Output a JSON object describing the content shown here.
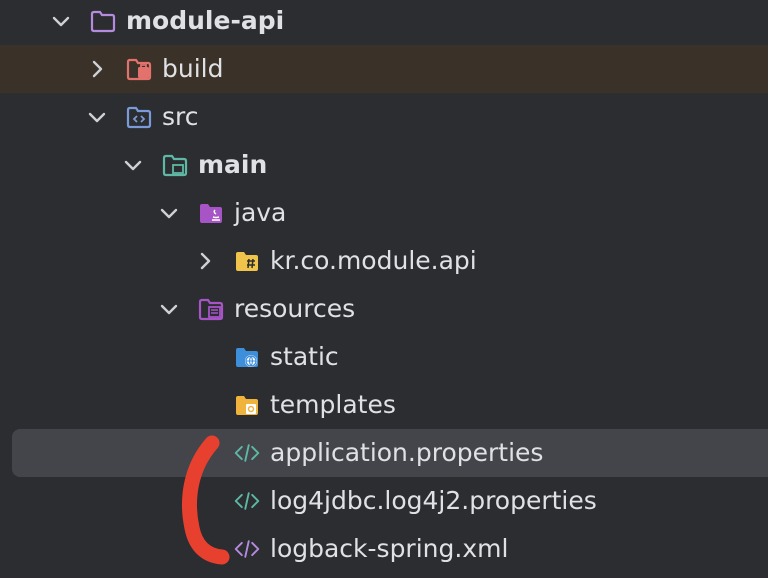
{
  "project_tree": {
    "module": "module-api",
    "build": "build",
    "src": "src",
    "main": "main",
    "java": "java",
    "package": "kr.co.module.api",
    "resources": "resources",
    "static": "static",
    "templates": "templates",
    "files": [
      "application.properties",
      "log4jdbc.log4j2.properties",
      "logback-spring.xml"
    ]
  },
  "colors": {
    "background": "#2b2d30",
    "selection": "#43454a",
    "build_highlight": "#3a3128",
    "annotation": "#e8402f",
    "properties_icon": "#5fb8a6",
    "xml_icon": "#b58be0",
    "folder_module": "#b58be0",
    "folder_excluded": "#e3726d",
    "folder_java": "#a654c6",
    "folder_package": "#f0c34a",
    "folder_static": "#3d8fdb",
    "folder_templates": "#f0b33c"
  }
}
